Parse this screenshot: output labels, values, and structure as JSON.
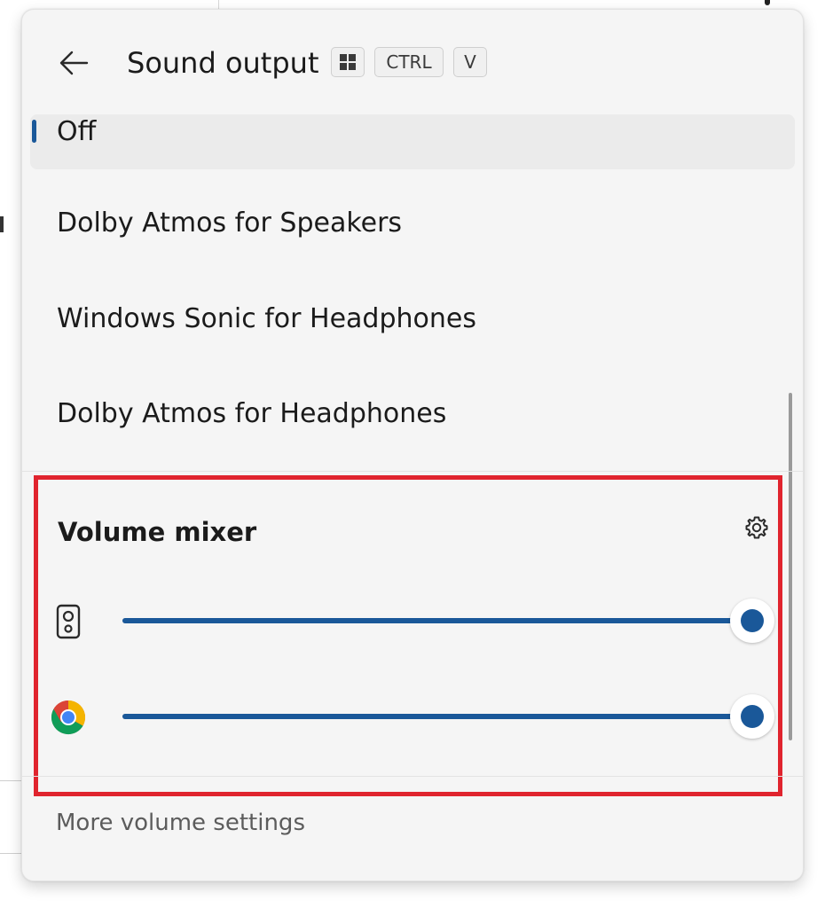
{
  "header": {
    "title": "Sound output",
    "back_icon": "arrow-left-icon",
    "shortcut_keys": [
      {
        "label": "",
        "icon": "windows-logo-icon"
      },
      {
        "label": "CTRL"
      },
      {
        "label": "V"
      }
    ]
  },
  "options": [
    {
      "label": "Off",
      "selected": true
    },
    {
      "label": "Dolby Atmos for Speakers",
      "selected": false
    },
    {
      "label": "Windows Sonic for Headphones",
      "selected": false
    },
    {
      "label": "Dolby Atmos for Headphones",
      "selected": false
    }
  ],
  "mixer": {
    "title": "Volume mixer",
    "settings_icon": "gear-icon",
    "highlight_color": "#e0242e",
    "sliders": [
      {
        "app_icon": "speaker-icon",
        "value_percent": 100
      },
      {
        "app_icon": "chrome-icon",
        "value_percent": 100
      }
    ]
  },
  "footer": {
    "link": "More volume settings"
  },
  "colors": {
    "accent": "#1a5899",
    "panel_bg": "#f5f5f5",
    "selected_bg": "#ebebeb"
  }
}
